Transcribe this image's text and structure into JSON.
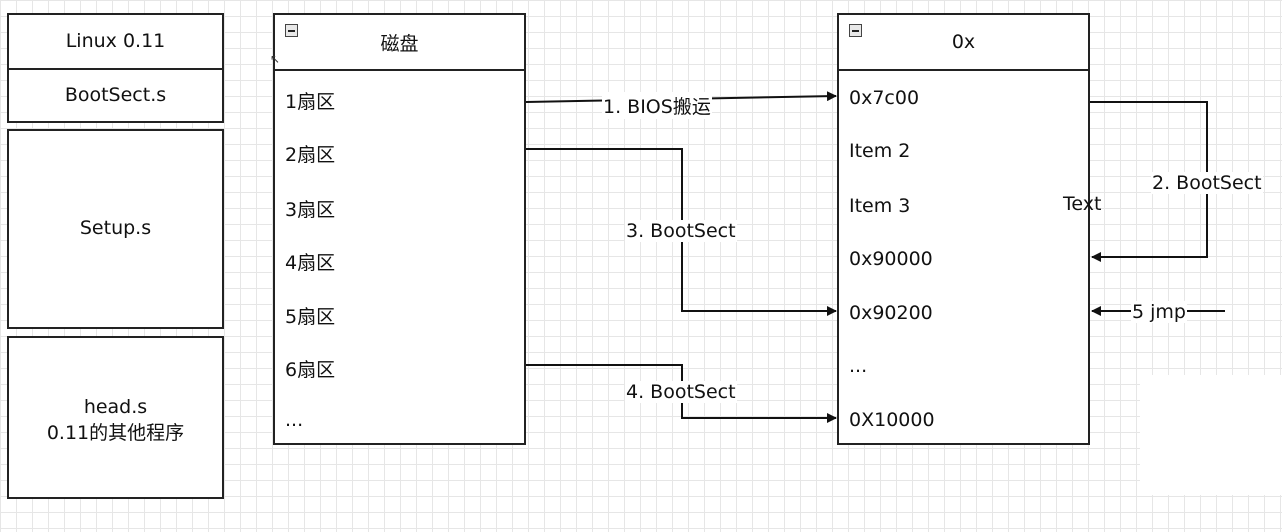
{
  "left_boxes": [
    {
      "label": "Linux 0.11"
    },
    {
      "label": "BootSect.s"
    },
    {
      "label": "Setup.s"
    },
    {
      "line1": "head.s",
      "line2": "0.11的其他程序"
    }
  ],
  "disk": {
    "title": "磁盘",
    "rows": [
      "1扇区",
      "2扇区",
      "3扇区",
      "4扇区",
      "5扇区",
      "6扇区",
      "..."
    ]
  },
  "memory": {
    "title": "0x",
    "rows": [
      "0x7c00",
      "Item 2",
      "Item 3",
      "0x90000",
      "0x90200",
      "...",
      "0X10000"
    ],
    "floating_text": "Text"
  },
  "arrow_labels": {
    "a1": "1. BIOS搬运",
    "a2": "2. BootSect",
    "a3": "3. BootSect",
    "a4": "4. BootSect",
    "a5": "5 jmp"
  }
}
